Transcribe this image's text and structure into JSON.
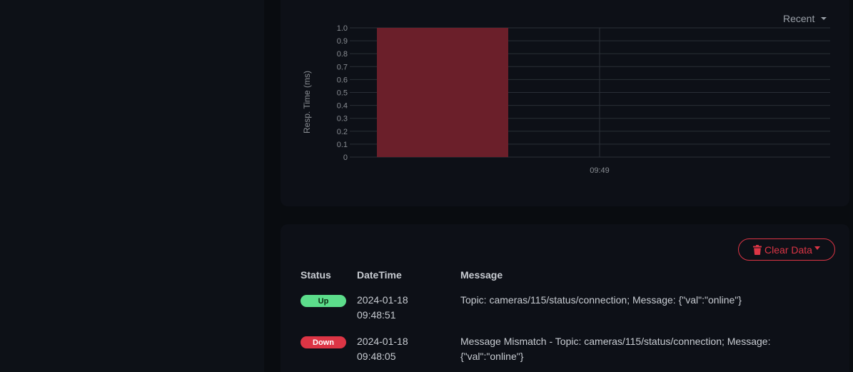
{
  "chart": {
    "period_label": "Recent",
    "colors": {
      "bar": "#6b1f2a",
      "grid": "#2a2f37",
      "tick": "#888c92"
    }
  },
  "chart_data": {
    "type": "bar",
    "title": "",
    "xlabel": "",
    "ylabel": "Resp. Time (ms)",
    "ylim": [
      0,
      1.0
    ],
    "yticks": [
      "1.0",
      "0.9",
      "0.8",
      "0.7",
      "0.6",
      "0.5",
      "0.4",
      "0.3",
      "0.2",
      "0.1",
      "0"
    ],
    "x_tick_labels": [
      "09:49"
    ],
    "bars": [
      {
        "label": "down",
        "value": 1.0,
        "color": "#6b1f2a"
      }
    ],
    "grid": true
  },
  "events": {
    "clear_label": "Clear Data",
    "headers": {
      "status": "Status",
      "datetime": "DateTime",
      "message": "Message"
    },
    "rows": [
      {
        "status": "Up",
        "date": "2024-01-18",
        "time": "09:48:51",
        "message": "Topic: cameras/115/status/connection; Message: {\"val\":\"online\"}"
      },
      {
        "status": "Down",
        "date": "2024-01-18",
        "time": "09:48:05",
        "message": "Message Mismatch - Topic: cameras/115/status/connection; Message: {\"val\":\"online\"}"
      }
    ],
    "colors": {
      "up": "#5cdd8b",
      "down": "#dc3545"
    }
  }
}
